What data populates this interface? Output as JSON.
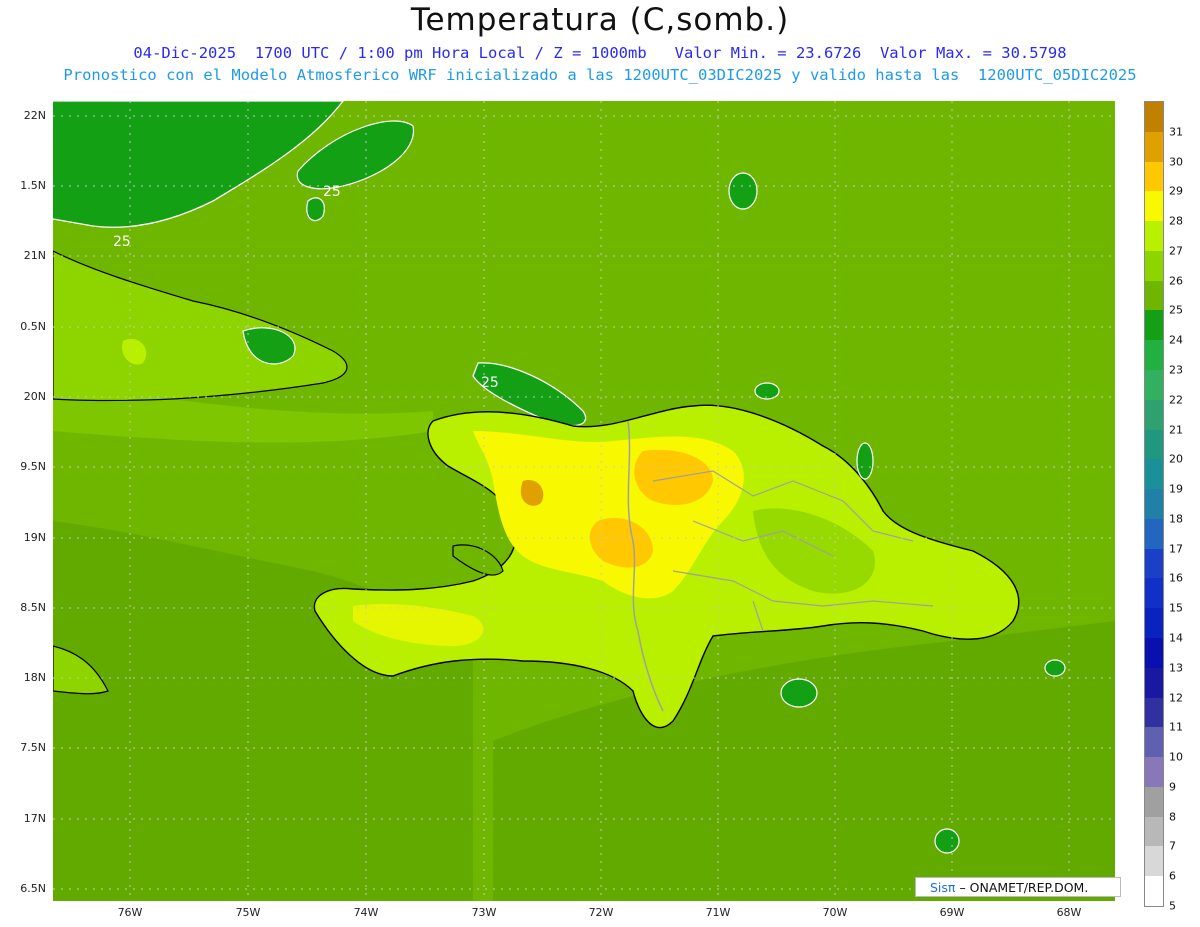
{
  "title": "Temperatura (C,somb.)",
  "subtitle1": "04-Dic-2025  1700 UTC / 1:00 pm Hora Local / Z = 1000mb   Valor Min. = 23.6726  Valor Max. = 30.5798",
  "subtitle2": "Pronostico con el Modelo Atmosferico WRF inicializado a las 1200UTC_03DIC2025 y valido hasta las  1200UTC_05DIC2025",
  "y_labels": [
    "22N",
    "1.5N",
    "21N",
    "0.5N",
    "20N",
    "9.5N",
    "19N",
    "8.5N",
    "18N",
    "7.5N",
    "17N",
    "6.5N"
  ],
  "x_labels": [
    "76W",
    "75W",
    "74W",
    "73W",
    "72W",
    "71W",
    "70W",
    "69W",
    "68W"
  ],
  "contour_labels": [
    "25",
    "25",
    "25"
  ],
  "legend": {
    "labels": [
      "31",
      "30",
      "29",
      "28",
      "27",
      "26",
      "25",
      "24",
      "23",
      "22",
      "21",
      "20",
      "19",
      "18",
      "17",
      "16",
      "15",
      "14",
      "13",
      "12",
      "11",
      "10",
      "9",
      "8",
      "7",
      "6",
      "5"
    ],
    "colors": [
      "#c08000",
      "#e0a000",
      "#ffc800",
      "#f8f800",
      "#b8f000",
      "#8ed500",
      "#6fb600",
      "#14a014",
      "#22b040",
      "#32b060",
      "#2fa070",
      "#209880",
      "#1a9098",
      "#2080a8",
      "#2266c0",
      "#1a40c8",
      "#1030c8",
      "#0a22c0",
      "#0a10b0",
      "#1818a0",
      "#3030a0",
      "#6060b0",
      "#8878b8",
      "#a0a0a0",
      "#b8b8b8",
      "#d8d8d8",
      "#ffffff"
    ]
  },
  "credit_brand": "Sisπ",
  "credit_text": "– ONAMET/REP.DOM.",
  "palette": {
    "sea": "#6fb600",
    "sea_dark": "#5aa000",
    "cool": "#14a014",
    "land_warm": "#b8f000",
    "land_hot": "#f8f800",
    "land_hotter": "#ffc800",
    "land_hottest": "#e0a000",
    "coast": "#000000",
    "borders": "#a0a0a0",
    "contour": "#ffffff"
  }
}
